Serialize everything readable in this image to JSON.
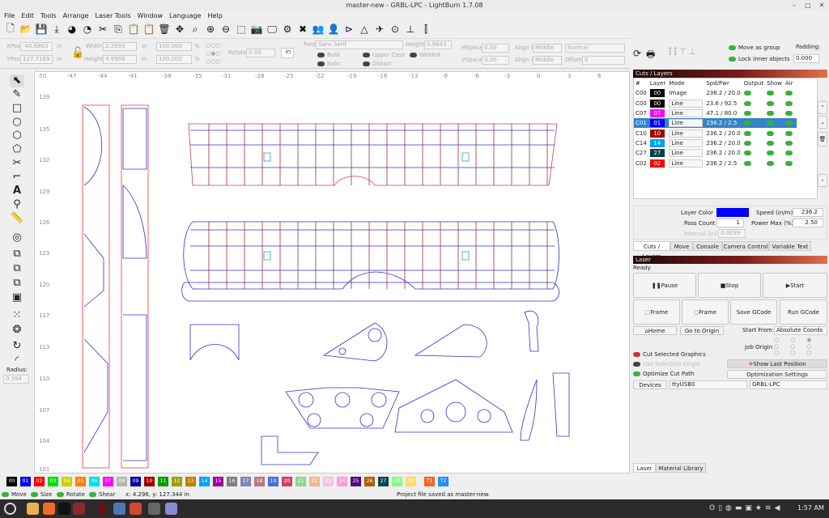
{
  "window": {
    "title": "master-new - GRBL-LPC - LightBurn 1.7.08"
  },
  "menu": [
    "File",
    "Edit",
    "Tools",
    "Arrange",
    "Laser Tools",
    "Window",
    "Language",
    "Help"
  ],
  "toolbar_icons": [
    "new-file",
    "open-folder",
    "save",
    "import",
    "undo",
    "redo",
    "cut",
    "copy",
    "paste",
    "duplicate-paste",
    "delete",
    "move",
    "zoom-fit",
    "zoom-in",
    "zoom-out",
    "frame-selection",
    "camera",
    "monitor",
    "gear",
    "wrench",
    "group",
    "ungroup",
    "mirror-h",
    "mirror-v",
    "send",
    "target",
    "align-bottom",
    "distribute"
  ],
  "props": {
    "xpos_label": "XPos",
    "xpos": "-40.6863",
    "ypos_label": "YPos",
    "ypos": "127.7169",
    "unit": "in",
    "width_label": "Width",
    "width": "2.2893",
    "height_label": "Height",
    "height": "4.9908",
    "scale_w": "100.000",
    "scale_h": "100.000",
    "pct": "%",
    "rotate_label": "Rotate",
    "rotate": "0.00",
    "units_btn": "in",
    "font_label": "Font",
    "font": "Sans Serif",
    "fheight_label": "Height",
    "fheight": "0.9843",
    "hspace_label": "HSpace",
    "hspace": "0.00",
    "vspace_label": "VSpace",
    "vspace": "0.00",
    "alignx_label": "Align X",
    "alignx": "Middle",
    "aligny_label": "Align Y",
    "aligny": "Middle",
    "normal": "Normal",
    "offset_label": "Offset",
    "offset": "0",
    "bold": "Bold",
    "italic": "Italic",
    "upper": "Upper Case",
    "distort": "Distort",
    "welded": "Welded"
  },
  "right_top": {
    "move_group": "Move as group",
    "lock_inner": "Lock inner objects",
    "padding_label": "Padding:",
    "padding": "0.000"
  },
  "cuts": {
    "title": "Cuts / Layers",
    "headers": [
      "#",
      "Layer",
      "Mode",
      "Spd/Pwr",
      "Output",
      "Show",
      "Air"
    ],
    "rows": [
      {
        "id": "C00",
        "layer": "00",
        "color": "#000000",
        "mode": "Image",
        "sp": "236.2 / 20.0",
        "dropdown": false
      },
      {
        "id": "C00",
        "layer": "00",
        "color": "#000000",
        "mode": "Line",
        "sp": "23.6 / 92.5",
        "dropdown": true
      },
      {
        "id": "C07",
        "layer": "07",
        "color": "#ff00ff",
        "mode": "Line",
        "sp": "47.1 / 80.0",
        "dropdown": true
      },
      {
        "id": "C01",
        "layer": "01",
        "color": "#0000ff",
        "mode": "Line",
        "sp": "236.2 / 2.5",
        "dropdown": true,
        "selected": true
      },
      {
        "id": "C10",
        "layer": "10",
        "color": "#a00000",
        "mode": "Line",
        "sp": "236.2 / 20.0",
        "dropdown": true
      },
      {
        "id": "C14",
        "layer": "14",
        "color": "#00a0f0",
        "mode": "Line",
        "sp": "236.2 / 20.0",
        "dropdown": true
      },
      {
        "id": "C27",
        "layer": "27",
        "color": "#004050",
        "mode": "Line",
        "sp": "236.2 / 20.0",
        "dropdown": true
      },
      {
        "id": "C02",
        "layer": "02",
        "color": "#ff0000",
        "mode": "Line",
        "sp": "236.2 / 2.5",
        "dropdown": true
      }
    ],
    "layer_color_label": "Layer Color",
    "layer_color": "#0000ff",
    "speed_label": "Speed (in/m)",
    "speed": "236.2",
    "pass_label": "Pass Count",
    "pass": "1",
    "power_label": "Power Max (%)",
    "power": "2.50",
    "interval_label": "Interval (in)",
    "interval": "0.0039",
    "tabs": [
      "Cuts / Layers",
      "Move",
      "Console",
      "Camera Control",
      "Variable Text"
    ]
  },
  "laser": {
    "title": "Laser",
    "status": "Ready",
    "pause": "Pause",
    "stop": "Stop",
    "start": "Start",
    "frame1": "Frame",
    "frame2": "Frame",
    "save_gcode": "Save GCode",
    "run_gcode": "Run GCode",
    "home": "Home",
    "go_origin": "Go to Origin",
    "start_from_label": "Start From:",
    "start_from": "Absolute Coords",
    "job_origin": "Job Origin",
    "cut_selected": "Cut Selected Graphics",
    "use_sel_origin": "Use Selection Origin",
    "optimize": "Optimize Cut Path",
    "show_last": "Show Last Position",
    "opt_settings": "Optimization Settings",
    "devices": "Devices",
    "port": "ttyUSB0",
    "device": "GRBL-LPC",
    "tabs": [
      "Laser",
      "Material Library"
    ]
  },
  "left_tools": {
    "radius_label": "Radius:",
    "radius": "0.394"
  },
  "ruler": {
    "x": [
      "-50",
      "-47",
      "-44",
      "-41",
      "-38",
      "-35",
      "-31",
      "-28",
      "-25",
      "-22",
      "-19",
      "-16",
      "-13",
      "-9",
      "-6",
      "-3",
      "0",
      "3",
      "6"
    ],
    "y": [
      "139",
      "135",
      "132",
      "129",
      "126",
      "123",
      "120",
      "117",
      "113",
      "110",
      "107",
      "104",
      "101"
    ]
  },
  "palette": [
    {
      "l": "00",
      "c": "#000000"
    },
    {
      "l": "01",
      "c": "#0000ff"
    },
    {
      "l": "02",
      "c": "#ff0000"
    },
    {
      "l": "03",
      "c": "#00e000"
    },
    {
      "l": "04",
      "c": "#d0d000"
    },
    {
      "l": "05",
      "c": "#ff8000"
    },
    {
      "l": "06",
      "c": "#00e0e0"
    },
    {
      "l": "07",
      "c": "#ff00ff"
    },
    {
      "l": "08",
      "c": "#b4b4b4"
    },
    {
      "l": "09",
      "c": "#0000a0"
    },
    {
      "l": "10",
      "c": "#a00000"
    },
    {
      "l": "11",
      "c": "#00a000"
    },
    {
      "l": "12",
      "c": "#a0a000"
    },
    {
      "l": "13",
      "c": "#c08000"
    },
    {
      "l": "14",
      "c": "#00a0ff"
    },
    {
      "l": "15",
      "c": "#a000a0"
    },
    {
      "l": "16",
      "c": "#808080"
    },
    {
      "l": "17",
      "c": "#7d87b9"
    },
    {
      "l": "18",
      "c": "#bb7784"
    },
    {
      "l": "19",
      "c": "#4a6fe3"
    },
    {
      "l": "20",
      "c": "#d33f6a"
    },
    {
      "l": "21",
      "c": "#8cd78e"
    },
    {
      "l": "22",
      "c": "#f0b98d"
    },
    {
      "l": "23",
      "c": "#f6c4e1"
    },
    {
      "l": "24",
      "c": "#fa9ed4"
    },
    {
      "l": "25",
      "c": "#500a78"
    },
    {
      "l": "26",
      "c": "#b45a00"
    },
    {
      "l": "27",
      "c": "#004754"
    },
    {
      "l": "28",
      "c": "#86fa88"
    },
    {
      "l": "29",
      "c": "#ffdb66"
    },
    {
      "l": "T1",
      "c": "#f36926"
    },
    {
      "l": "T2",
      "c": "#1e90ff"
    }
  ],
  "status": {
    "move": "Move",
    "size": "Size",
    "rotate": "Rotate",
    "shear": "Shear",
    "coords": "x: 4.296, y: 127.344 in",
    "message": "Project file saved as master-new."
  },
  "taskbar": {
    "clock": "1:57 AM"
  }
}
